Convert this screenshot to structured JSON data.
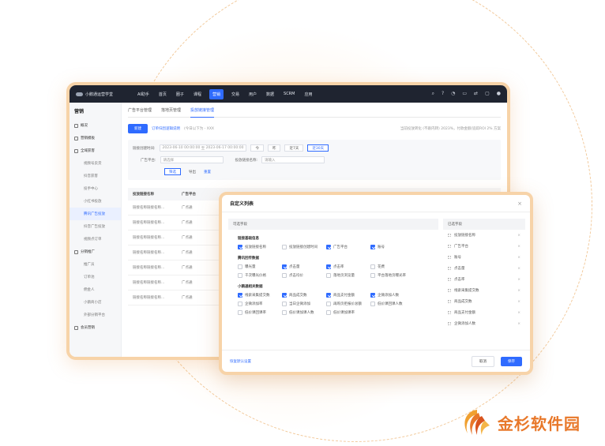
{
  "app": {
    "name": "小鹅通运营学堂"
  },
  "top_nav": [
    "AI助手",
    "首页",
    "圈子",
    "课程",
    "营销",
    "交易",
    "用户",
    "数据",
    "SCRM",
    "应用"
  ],
  "top_nav_active": 4,
  "sidebar": {
    "title": "营销",
    "groups": [
      {
        "label": "概况",
        "items": []
      },
      {
        "label": "营销模板",
        "items": []
      },
      {
        "label": "全域获客",
        "items": [
          "视频号卖货",
          "抖音获客",
          "投手中心",
          "小红书投放",
          "腾讯广告投放",
          "抖音广告投放",
          "视频点订单"
        ]
      },
      {
        "label": "分销推广",
        "items": [
          "推广员",
          "订单池",
          "佣金人",
          "小鹅商小店",
          "外部分销平台"
        ]
      },
      {
        "label": "会员营销",
        "items": []
      }
    ],
    "active_item": "腾讯广告投放"
  },
  "content": {
    "tabs": [
      "广告平台管理",
      "落地页管理",
      "投放链接管理"
    ],
    "active_tab": 2,
    "new_button": "新建",
    "tip_link": "订单归因逻辑说明",
    "tip_text": "(今日以下为 - XXX",
    "right_info": "当前投放转化 (不跟内转) 2023%，付款金额/追踪ROI 2%  方案",
    "filter": {
      "date_label": "链接创建时间:",
      "date_start": "2023-06-10 00:00:00",
      "date_sep": "至",
      "date_end": "2023-06-17 00:00:00",
      "quick": [
        "今",
        "昨",
        "近7天",
        "近30天"
      ],
      "platform_label": "广告平台:",
      "platform_placeholder": "请选择",
      "name_label": "投放链接名称:",
      "name_placeholder": "请输入",
      "search_btn": "筛选",
      "export_btn": "导出",
      "reset_btn": "重置"
    },
    "table": {
      "headers": [
        "投放链接名称",
        "广告平台"
      ],
      "rows": [
        [
          "链接名称链接名称...",
          "广点通"
        ],
        [
          "链接名称链接名称...",
          "广点通"
        ],
        [
          "链接名称链接名称...",
          "广点通"
        ],
        [
          "链接名称链接名称...",
          "广点通"
        ],
        [
          "链接名称链接名称...",
          "广点通"
        ],
        [
          "链接名称链接名称...",
          "广点通"
        ],
        [
          "链接名称链接名称...",
          "广点通"
        ]
      ]
    }
  },
  "dialog": {
    "title": "自定义列表",
    "left_header": "可选字段",
    "sections": [
      {
        "title": "链接基础信息",
        "options": [
          {
            "label": "投放链接名称",
            "checked": true
          },
          {
            "label": "投放链接创建时间",
            "checked": false
          },
          {
            "label": "广告平台",
            "checked": true
          },
          {
            "label": "账号",
            "checked": true
          }
        ]
      },
      {
        "title": "腾讯回传数据",
        "options": [
          {
            "label": "曝光量",
            "checked": false
          },
          {
            "label": "点击量",
            "checked": true
          },
          {
            "label": "点击率",
            "checked": true
          },
          {
            "label": "花费",
            "checked": false
          },
          {
            "label": "千次曝光价格",
            "checked": false
          },
          {
            "label": "点击均价",
            "checked": false
          },
          {
            "label": "落地页浏览量",
            "checked": false
          },
          {
            "label": "平台落地页曝光率",
            "checked": false
          }
        ]
      },
      {
        "title": "小鹅通相关数据",
        "options": [
          {
            "label": "线索采集提交数",
            "checked": true
          },
          {
            "label": "商品成交数",
            "checked": true
          },
          {
            "label": "商品支付金额",
            "checked": true
          },
          {
            "label": "企微添加人数",
            "checked": true
          },
          {
            "label": "企微添加率",
            "checked": false
          },
          {
            "label": "当日企微添加",
            "checked": false
          },
          {
            "label": "再购页拒报价总额",
            "checked": false
          },
          {
            "label": "低价课回课人数",
            "checked": false
          },
          {
            "label": "低价课回课率",
            "checked": false
          },
          {
            "label": "低价课加课人数",
            "checked": false
          },
          {
            "label": "低价课加课率",
            "checked": false
          }
        ]
      }
    ],
    "right_header": "已选字段",
    "selected": [
      "投放链接名称",
      "广告平台",
      "账号",
      "点击量",
      "点击率",
      "线索采集提交数",
      "商品成交数",
      "商品支付金额",
      "企微添加人数"
    ],
    "restore_link": "恢复默认设置",
    "cancel_btn": "取消",
    "ok_btn": "保存"
  },
  "watermark": {
    "text": "金杉软件园"
  }
}
